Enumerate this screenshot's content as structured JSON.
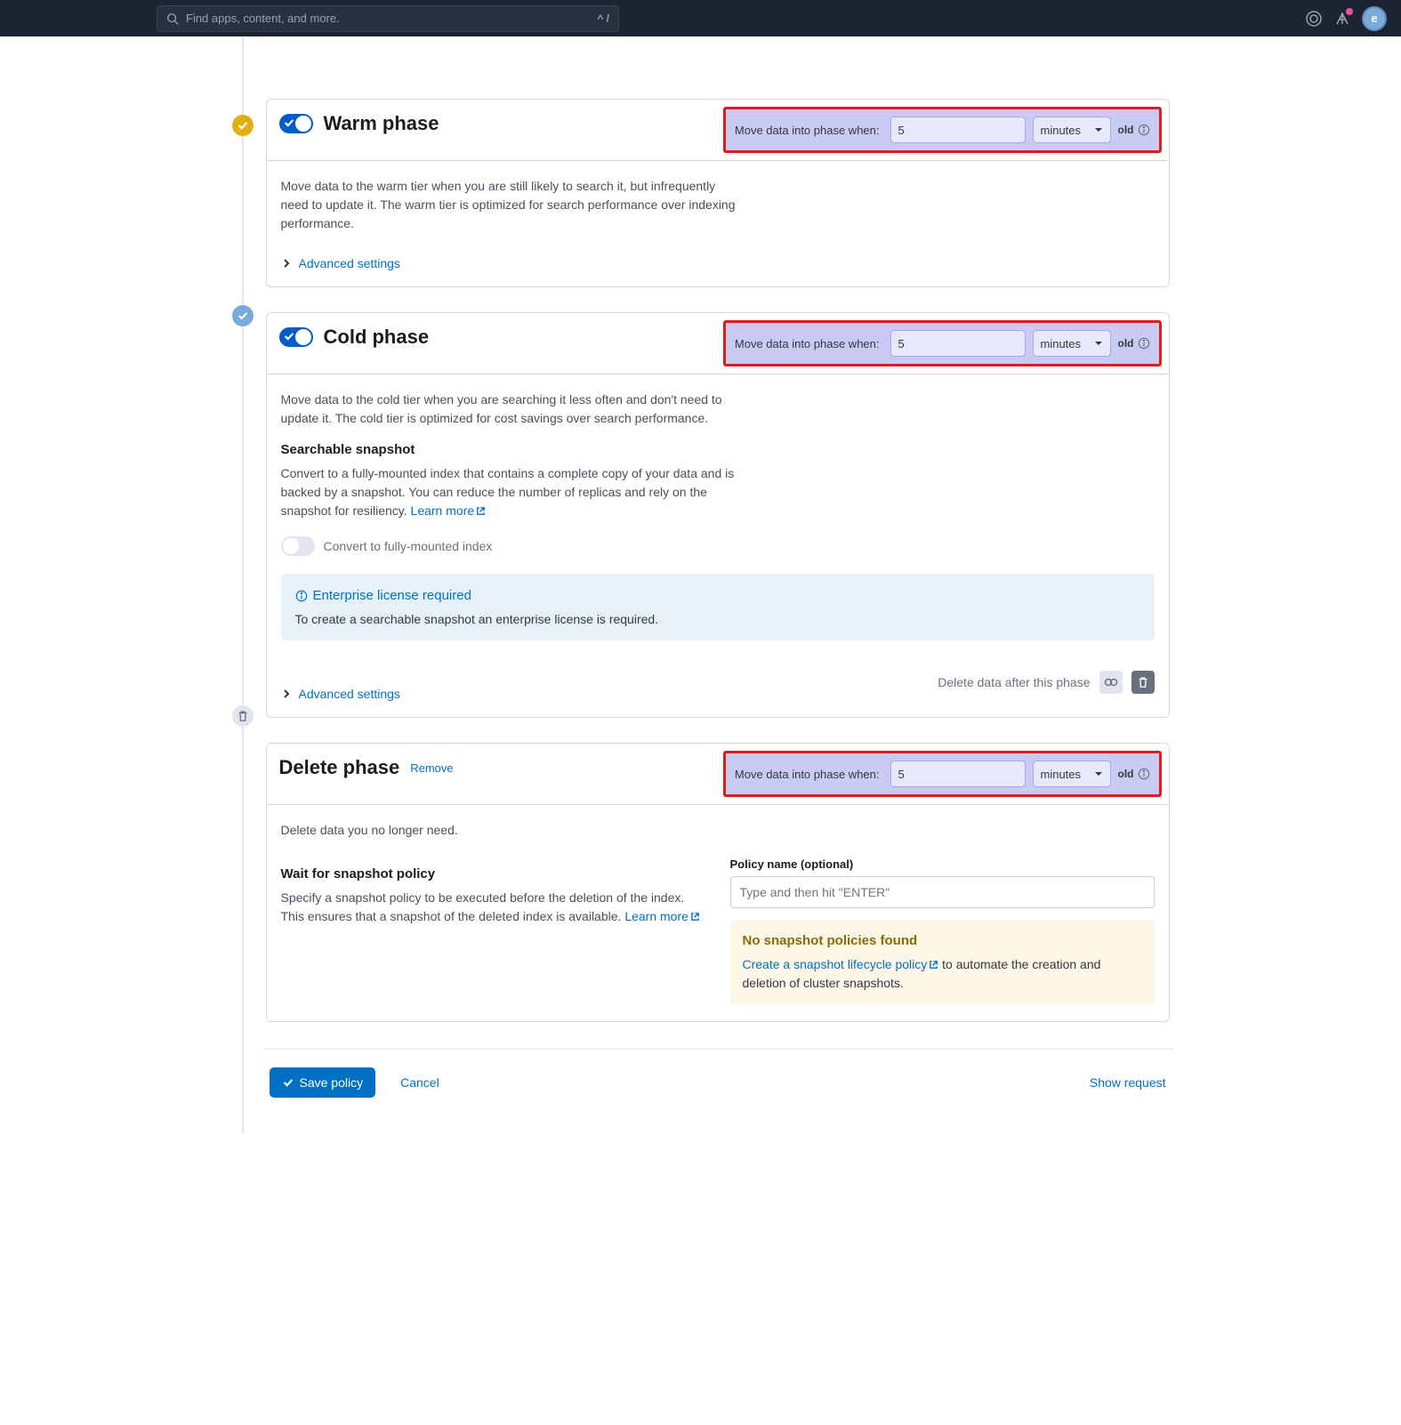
{
  "header": {
    "search_placeholder": "Find apps, content, and more.",
    "kbd_hint": "^ /",
    "avatar_letter": "e"
  },
  "warm": {
    "title": "Warm phase",
    "desc": "Move data to the warm tier when you are still likely to search it, but infrequently need to update it. The warm tier is optimized for search performance over indexing performance.",
    "adv": "Advanced settings",
    "move_label": "Move data into phase when:",
    "value": "5",
    "unit": "minutes",
    "old": "old"
  },
  "cold": {
    "title": "Cold phase",
    "desc": "Move data to the cold tier when you are searching it less often and don't need to update it. The cold tier is optimized for cost savings over search performance.",
    "snap_h": "Searchable snapshot",
    "snap_desc": "Convert to a fully-mounted index that contains a complete copy of your data and is backed by a snapshot. You can reduce the number of replicas and rely on the snapshot for resiliency. ",
    "learn": "Learn more",
    "convert_label": "Convert to fully-mounted index",
    "callout_title": "Enterprise license required",
    "callout_body": "To create a searchable snapshot an enterprise license is required.",
    "adv": "Advanced settings",
    "delete_after": "Delete data after this phase",
    "move_label": "Move data into phase when:",
    "value": "5",
    "unit": "minutes",
    "old": "old"
  },
  "del": {
    "title": "Delete phase",
    "remove": "Remove",
    "desc": "Delete data you no longer need.",
    "wait_h": "Wait for snapshot policy",
    "wait_desc": "Specify a snapshot policy to be executed before the deletion of the index. This ensures that a snapshot of the deleted index is available. ",
    "learn": "Learn more",
    "policy_label": "Policy name (optional)",
    "policy_placeholder": "Type and then hit \"ENTER\"",
    "warn_title": "No snapshot policies found",
    "warn_link": "Create a snapshot lifecycle policy",
    "warn_rest": " to automate the creation and deletion of cluster snapshots.",
    "move_label": "Move data into phase when:",
    "value": "5",
    "unit": "minutes",
    "old": "old"
  },
  "footer": {
    "save": "Save policy",
    "cancel": "Cancel",
    "show_request": "Show request"
  }
}
